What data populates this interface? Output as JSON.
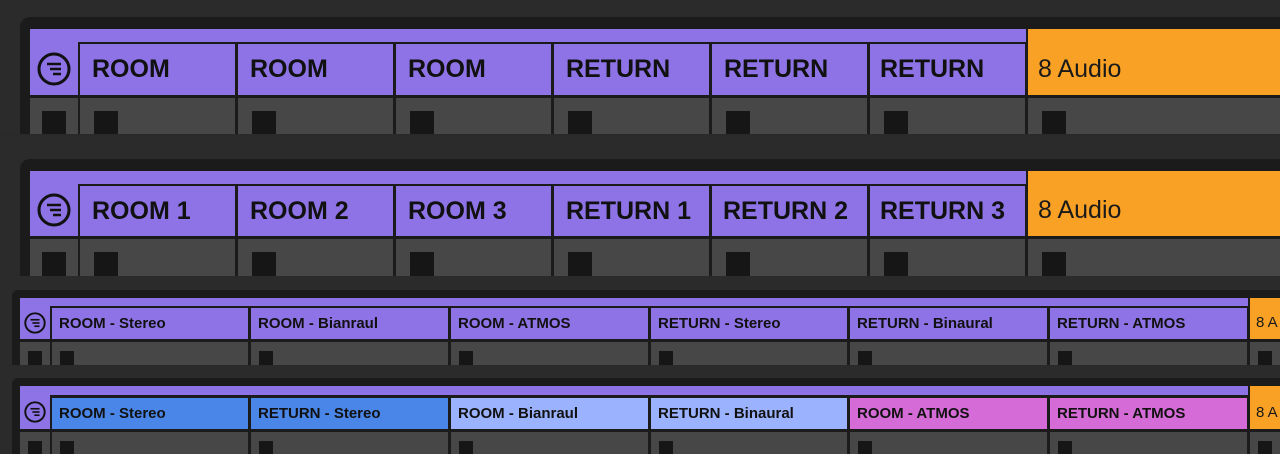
{
  "colors": {
    "group_purple": "#8d73e6",
    "audio_orange": "#f9a125",
    "blue": "#4a86e8",
    "light_blue": "#9bb3ff",
    "pink": "#d46bd6",
    "frame": "#1b1b1b",
    "slot": "#474747"
  },
  "icons": {
    "group_fold": "group-fold-icon",
    "clip_stop": "stop-square-icon"
  },
  "variant1": {
    "tracks": [
      {
        "label": "ROOM"
      },
      {
        "label": "ROOM"
      },
      {
        "label": "ROOM"
      },
      {
        "label": "RETURN"
      },
      {
        "label": "RETURN"
      },
      {
        "label": "RETURN"
      }
    ],
    "audio": "8 Audio"
  },
  "variant2": {
    "tracks": [
      {
        "label": "ROOM 1"
      },
      {
        "label": "ROOM 2"
      },
      {
        "label": "ROOM 3"
      },
      {
        "label": "RETURN 1"
      },
      {
        "label": "RETURN 2"
      },
      {
        "label": "RETURN 3"
      }
    ],
    "audio": "8 Audio"
  },
  "variant3": {
    "tracks": [
      {
        "label": "ROOM - Stereo"
      },
      {
        "label": "ROOM - Bianraul"
      },
      {
        "label": "ROOM - ATMOS"
      },
      {
        "label": "RETURN - Stereo"
      },
      {
        "label": "RETURN - Binaural"
      },
      {
        "label": "RETURN - ATMOS"
      }
    ],
    "audio": "8 A"
  },
  "variant4": {
    "tracks": [
      {
        "label": "ROOM - Stereo",
        "color": "#4a86e8"
      },
      {
        "label": "RETURN - Stereo",
        "color": "#4a86e8"
      },
      {
        "label": "ROOM - Bianraul",
        "color": "#9bb3ff"
      },
      {
        "label": "RETURN - Binaural",
        "color": "#9bb3ff"
      },
      {
        "label": "ROOM - ATMOS",
        "color": "#d46bd6"
      },
      {
        "label": "RETURN - ATMOS",
        "color": "#d46bd6"
      }
    ],
    "audio": "8 A"
  }
}
